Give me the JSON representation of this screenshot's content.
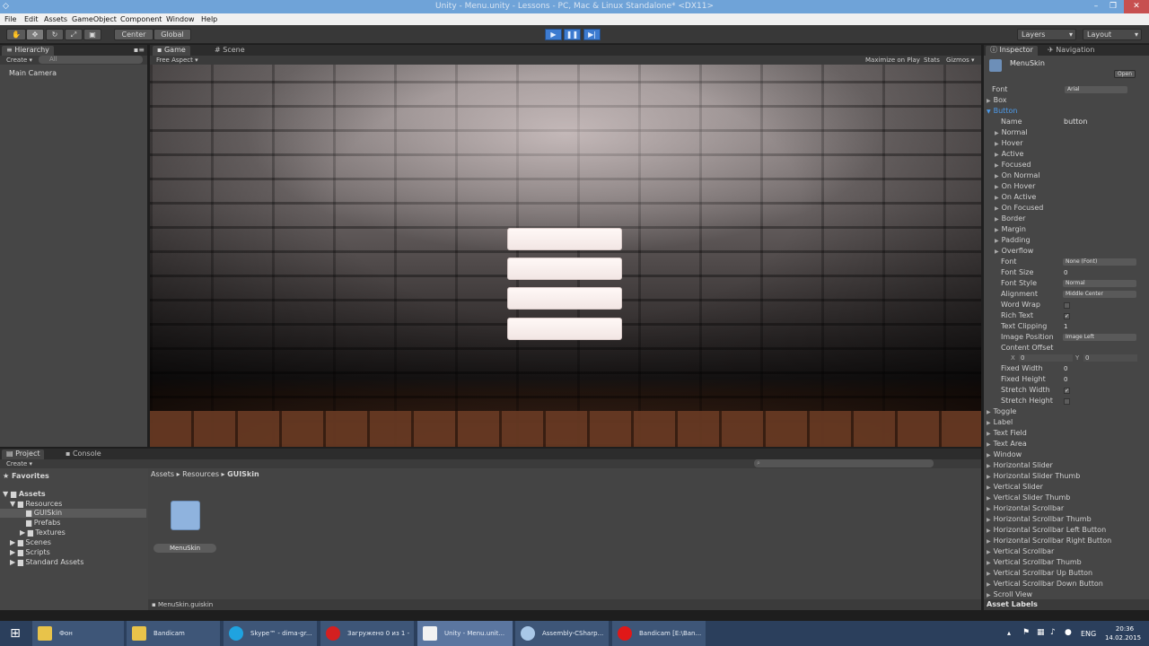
{
  "window": {
    "title": "Unity - Menu.unity - Lessons - PC, Mac & Linux Standalone* <DX11>"
  },
  "menu": [
    "File",
    "Edit",
    "Assets",
    "GameObject",
    "Component",
    "Window",
    "Help"
  ],
  "toolbar": {
    "center": "Center",
    "global": "Global",
    "layers": "Layers",
    "layout": "Layout"
  },
  "hierarchy": {
    "tab": "Hierarchy",
    "create": "Create",
    "search": "All",
    "items": [
      "Main Camera"
    ]
  },
  "game": {
    "tab_game": "Game",
    "tab_scene": "Scene",
    "aspect": "Free Aspect",
    "maximize": "Maximize on Play",
    "stats": "Stats",
    "gizmos": "Gizmos",
    "button_count": 4
  },
  "inspector": {
    "tab": "Inspector",
    "tab_nav": "Navigation",
    "object": "MenuSkin",
    "open": "Open",
    "font_label": "Font",
    "font_value": "Arial",
    "box": "Box",
    "button": "Button",
    "name_label": "Name",
    "name_value": "button",
    "states": [
      "Normal",
      "Hover",
      "Active",
      "Focused",
      "On Normal",
      "On Hover",
      "On Active",
      "On Focused",
      "Border",
      "Margin",
      "Padding",
      "Overflow"
    ],
    "props": {
      "font": "Font",
      "font_val": "None (Font)",
      "font_size": "Font Size",
      "font_size_val": "0",
      "font_style": "Font Style",
      "font_style_val": "Normal",
      "alignment": "Alignment",
      "alignment_val": "Middle Center",
      "word_wrap": "Word Wrap",
      "rich_text": "Rich Text",
      "text_clipping": "Text Clipping",
      "text_clipping_val": "1",
      "image_position": "Image Position",
      "image_position_val": "Image Left",
      "content_offset": "Content Offset",
      "x": "X",
      "x_val": "0",
      "y": "Y",
      "y_val": "0",
      "fixed_width": "Fixed Width",
      "fixed_width_val": "0",
      "fixed_height": "Fixed Height",
      "fixed_height_val": "0",
      "stretch_width": "Stretch Width",
      "stretch_height": "Stretch Height"
    },
    "sections": [
      "Toggle",
      "Label",
      "Text Field",
      "Text Area",
      "Window",
      "Horizontal Slider",
      "Horizontal Slider Thumb",
      "Vertical Slider",
      "Vertical Slider Thumb",
      "Horizontal Scrollbar",
      "Horizontal Scrollbar Thumb",
      "Horizontal Scrollbar Left Button",
      "Horizontal Scrollbar Right Button",
      "Vertical Scrollbar",
      "Vertical Scrollbar Thumb",
      "Vertical Scrollbar Up Button",
      "Vertical Scrollbar Down Button",
      "Scroll View"
    ],
    "asset_labels": "Asset Labels"
  },
  "project": {
    "tab": "Project",
    "tab_console": "Console",
    "create": "Create",
    "favorites": "Favorites",
    "assets": "Assets",
    "tree": [
      "Resources",
      "GUISkin",
      "Prefabs",
      "Textures",
      "Scenes",
      "Scripts",
      "Standard Assets"
    ],
    "breadcrumb": [
      "Assets",
      "Resources",
      "GUISkin"
    ],
    "file": "MenuSkin",
    "footer": "MenuSkin.guiskin"
  },
  "taskbar": {
    "items": [
      "Фон",
      "Bandicam",
      "Skype™ - dima-gr...",
      "Загружено 0 из 1 - Д...",
      "Unity - Menu.unit...",
      "Assembly-CSharp...",
      "Bandicam [E:\\Ban..."
    ],
    "lang": "ENG",
    "time": "20:36",
    "date": "14.02.2015"
  }
}
